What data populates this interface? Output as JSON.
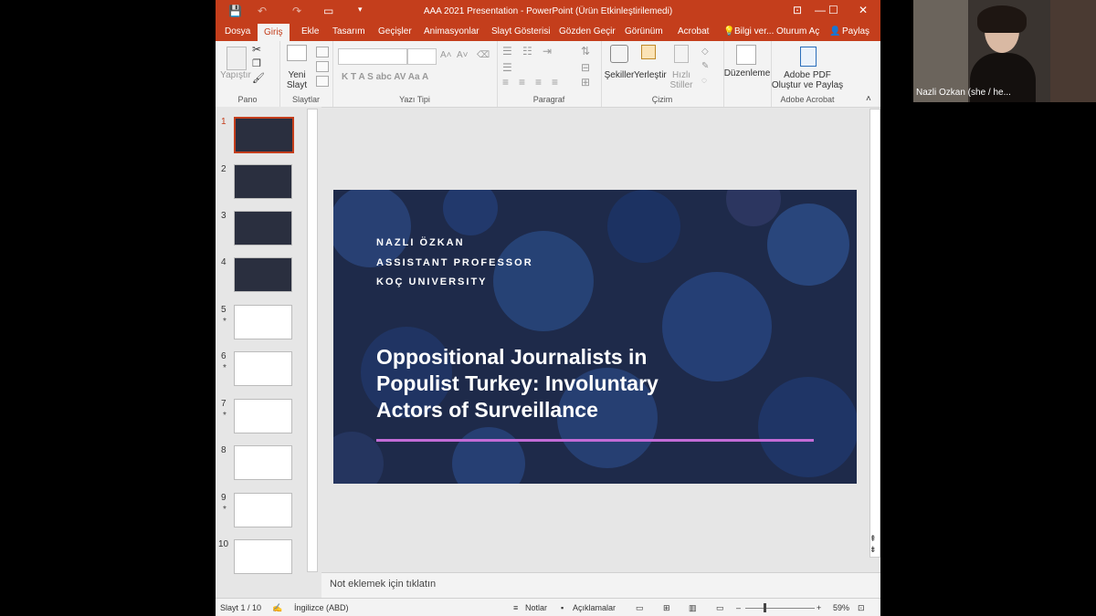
{
  "titlebar": {
    "title": "AAA 2021 Presentation - PowerPoint (Ürün Etkinleştirilemedi)",
    "window_buttons": [
      "⊡",
      "—",
      "☐",
      "✕"
    ]
  },
  "tabs": [
    "Dosya",
    "Giriş",
    "Ekle",
    "Tasarım",
    "Geçişler",
    "Animasyonlar",
    "Slayt Gösterisi",
    "Gözden Geçir",
    "Görünüm",
    "Acrobat"
  ],
  "active_tab": "Giriş",
  "tellme": "Bilgi ver...",
  "signin": "Oturum Aç",
  "share": "Paylaş",
  "ribbon": {
    "pano": {
      "paste": "Yapıştır",
      "label": "Pano"
    },
    "slaytlar": {
      "new_slide_1": "Yeni",
      "new_slide_2": "Slayt",
      "label": "Slaytlar"
    },
    "yazi_tipi": {
      "label": "Yazı Tipi",
      "glyphs": "K  T  A  S  abc  AV  Aa  A"
    },
    "paragraf": {
      "label": "Paragraf"
    },
    "cizim": {
      "shapes": "Şekiller",
      "arrange": "Yerleştir",
      "quick_styles_1": "Hızlı",
      "quick_styles_2": "Stiller",
      "label": "Çizim"
    },
    "duzenleme": {
      "label": "Düzenleme"
    },
    "acrobat": {
      "line1": "Adobe PDF",
      "line2": "Oluştur ve Paylaş",
      "label": "Adobe Acrobat"
    }
  },
  "slides": [
    {
      "num": "1",
      "star": ""
    },
    {
      "num": "2",
      "star": ""
    },
    {
      "num": "3",
      "star": ""
    },
    {
      "num": "4",
      "star": ""
    },
    {
      "num": "5",
      "star": "*"
    },
    {
      "num": "6",
      "star": "*"
    },
    {
      "num": "7",
      "star": "*"
    },
    {
      "num": "8",
      "star": ""
    },
    {
      "num": "9",
      "star": "*"
    },
    {
      "num": "10",
      "star": ""
    }
  ],
  "current_slide": {
    "author_name": "NAZLI ÖZKAN",
    "author_title": "ASSISTANT PROFESSOR",
    "author_affiliation": "KOÇ UNIVERSITY",
    "title_line1": "Oppositional Journalists in",
    "title_line2": "Populist Turkey: Involuntary",
    "title_line3": "Actors of Surveillance",
    "accent_color": "#c26bd6"
  },
  "notes_placeholder": "Not eklemek için tıklatın",
  "status": {
    "slide_count": "Slayt 1 / 10",
    "language": "İngilizce (ABD)",
    "notes": "Notlar",
    "comments": "Açıklamalar",
    "zoom": "59%"
  },
  "webcam": {
    "name": "Nazli Ozkan (she / he..."
  },
  "colors": {
    "brand": "#c43e1c",
    "ribbon_bg": "#f3f3f3",
    "slide_bg": "#1e2a4a"
  }
}
